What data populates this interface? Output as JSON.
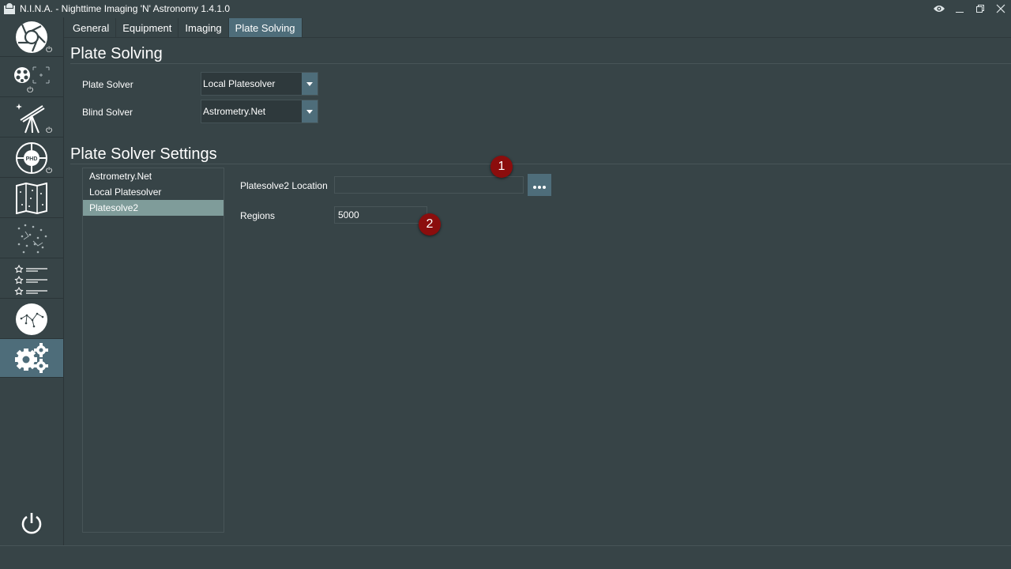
{
  "window": {
    "title": "N.I.N.A. - Nighttime Imaging 'N' Astronomy 1.4.1.0",
    "controls": [
      "eye-icon",
      "minimize-icon",
      "restore-icon",
      "close-icon"
    ]
  },
  "sidebar": {
    "items": [
      {
        "icon": "camera-aperture-icon",
        "power": true
      },
      {
        "icon": "filter-wheel-focus-icon",
        "power": true
      },
      {
        "icon": "telescope-icon",
        "power": true
      },
      {
        "icon": "phd-guider-icon",
        "power": true
      },
      {
        "icon": "sky-atlas-map-icon",
        "power": false
      },
      {
        "icon": "framing-stars-icon",
        "power": false
      },
      {
        "icon": "sequence-list-icon",
        "power": false
      },
      {
        "icon": "sky-constellation-icon",
        "power": false
      },
      {
        "icon": "settings-gears-icon",
        "power": false,
        "active": true
      }
    ],
    "bottom_icon": "power-icon"
  },
  "tabs": [
    {
      "label": "General"
    },
    {
      "label": "Equipment"
    },
    {
      "label": "Imaging"
    },
    {
      "label": "Plate Solving",
      "active": true
    }
  ],
  "plate_solving": {
    "title": "Plate Solving",
    "plate_solver_label": "Plate Solver",
    "plate_solver_value": "Local Platesolver",
    "blind_solver_label": "Blind Solver",
    "blind_solver_value": "Astrometry.Net"
  },
  "settings": {
    "title": "Plate Solver Settings",
    "solvers": [
      "Astrometry.Net",
      "Local Platesolver",
      "Platesolve2"
    ],
    "selected_solver": "Platesolve2",
    "location_label": "Platesolve2 Location",
    "location_value": "",
    "browse_label": "...",
    "regions_label": "Regions",
    "regions_value": "5000"
  },
  "annotations": [
    "1",
    "2"
  ],
  "colors": {
    "background": "#374447",
    "accent": "#4e6d7a",
    "selected": "#7f9c9a",
    "badge": "#8b0d0d"
  }
}
